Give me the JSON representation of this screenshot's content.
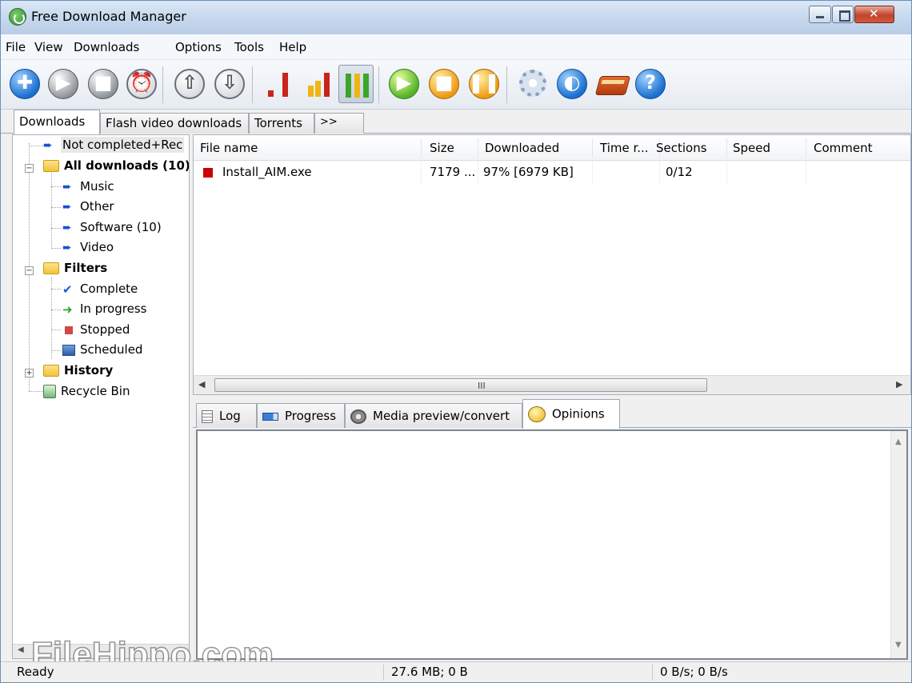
{
  "window": {
    "title": "Free Download Manager"
  },
  "menu": [
    "File",
    "View",
    "Downloads",
    "Options",
    "Tools",
    "Help"
  ],
  "toolbar": {
    "buttons": [
      "add-download",
      "start",
      "stop",
      "schedule",
      "move-up",
      "move-down",
      "speed-low",
      "speed-medium",
      "speed-high",
      "start-all",
      "stop-all",
      "pause-all",
      "settings",
      "site-explorer",
      "library",
      "help"
    ],
    "help_glyph": "?"
  },
  "top_tabs": [
    "Downloads",
    "Flash video downloads",
    "Torrents",
    ">>"
  ],
  "tree": {
    "not_completed": "Not completed+Rec",
    "all_downloads": "All downloads (10)",
    "music": "Music",
    "other": "Other",
    "software": "Software (10)",
    "video": "Video",
    "filters": "Filters",
    "complete": "Complete",
    "in_progress": "In progress",
    "stopped": "Stopped",
    "scheduled": "Scheduled",
    "history": "History",
    "recycle_bin": "Recycle Bin"
  },
  "list": {
    "columns": [
      "File name",
      "Size",
      "Downloaded",
      "Time r...",
      "Sections",
      "Speed",
      "Comment"
    ],
    "rows": [
      {
        "file_name": "Install_AIM.exe",
        "size": "7179 ...",
        "downloaded": "97% [6979 KB]",
        "time_remaining": "",
        "sections": "0/12",
        "speed": "",
        "comment": ""
      }
    ],
    "scroll_grip": "III"
  },
  "bottom_tabs": [
    "Log",
    "Progress",
    "Media preview/convert",
    "Opinions"
  ],
  "status": {
    "state": "Ready",
    "sizes": "27.6 MB; 0 B",
    "speeds": "0 B/s; 0 B/s"
  },
  "watermark": "FileHippo.com",
  "colors": {
    "stopped_marker": "#cc0000",
    "accent_blue": "#1a6fd0",
    "green": "#56b32a",
    "orange": "#f09a12"
  }
}
